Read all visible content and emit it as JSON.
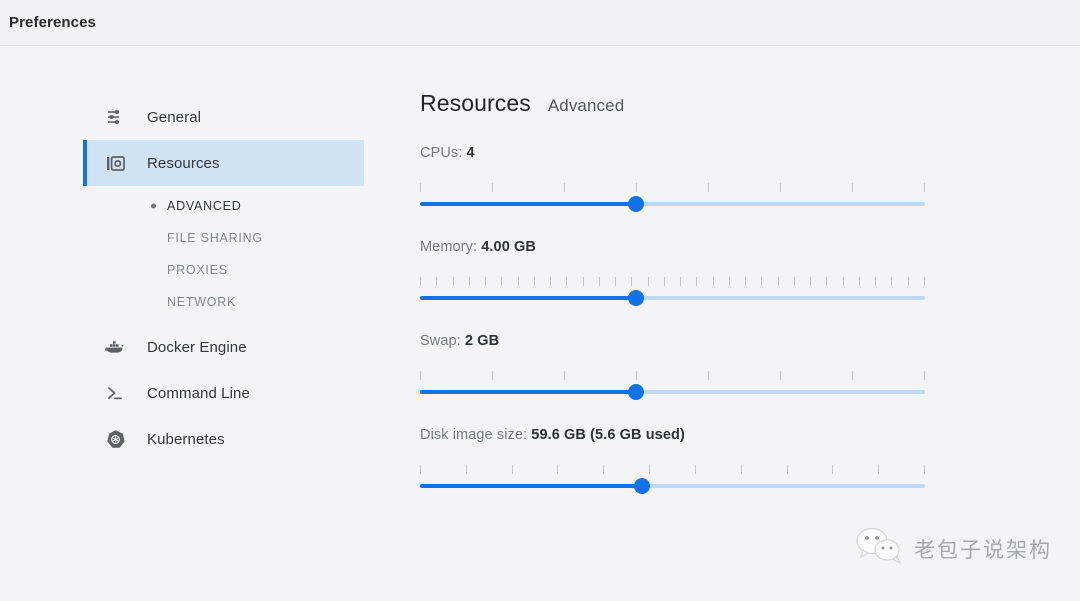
{
  "window": {
    "title": "Preferences"
  },
  "sidebar": {
    "items": [
      {
        "label": "General",
        "icon": "tune-sliders-icon",
        "selected": false
      },
      {
        "label": "Resources",
        "icon": "resources-box-icon",
        "selected": true
      },
      {
        "label": "Docker Engine",
        "icon": "docker-whale-icon",
        "selected": false
      },
      {
        "label": "Command Line",
        "icon": "terminal-prompt-icon",
        "selected": false
      },
      {
        "label": "Kubernetes",
        "icon": "kubernetes-helm-icon",
        "selected": false
      }
    ],
    "subitems": [
      {
        "label": "ADVANCED",
        "active": true
      },
      {
        "label": "FILE SHARING",
        "active": false
      },
      {
        "label": "PROXIES",
        "active": false
      },
      {
        "label": "NETWORK",
        "active": false
      }
    ]
  },
  "main": {
    "heading_primary": "Resources",
    "heading_secondary": "Advanced",
    "fields": [
      {
        "name": "cpus",
        "label_prefix": "CPUs: ",
        "label_value": "4",
        "ticks": 8,
        "fill_percent": 42.8
      },
      {
        "name": "memory",
        "label_prefix": "Memory: ",
        "label_value": "4.00 GB",
        "ticks": 32,
        "fill_percent": 42.8
      },
      {
        "name": "swap",
        "label_prefix": "Swap: ",
        "label_value": "2 GB",
        "ticks": 8,
        "fill_percent": 42.8
      },
      {
        "name": "disk-image-size",
        "label_prefix": "Disk image size: ",
        "label_value": "59.6 GB (5.6 GB used)",
        "ticks": 12,
        "fill_percent": 44.0
      }
    ]
  },
  "watermark": {
    "text": "老包子说架构",
    "icon": "wechat-icon"
  },
  "colors": {
    "accent": "#1372ea",
    "track": "#bcd8fb",
    "selected_row": "#cfe3f5",
    "background": "#f2f2f4"
  }
}
